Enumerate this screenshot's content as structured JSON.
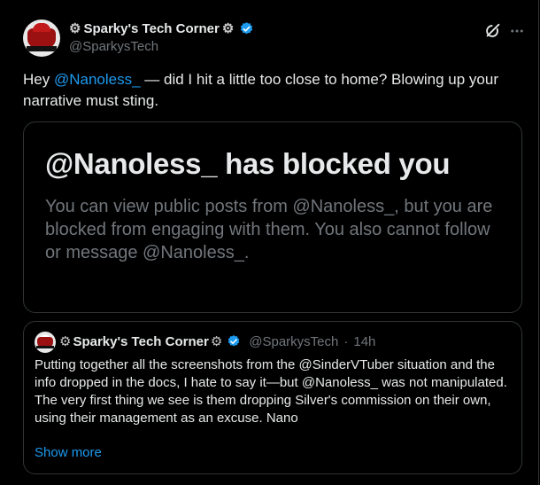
{
  "author": {
    "gear_left": "⚙",
    "name": "Sparky's Tech Corner",
    "gear_right": "⚙",
    "handle": "@SparkysTech"
  },
  "post": {
    "prefix": "Hey ",
    "mention": "@Nanoless_",
    "rest": " — did I hit a little too close to home? Blowing up your narrative must sting."
  },
  "screenshot": {
    "title": "@Nanoless_ has blocked you",
    "body": "You can view public posts from @Nanoless_, but you are blocked from engaging with them. You also cannot follow or message @Nanoless_."
  },
  "quote": {
    "gear_left": "⚙",
    "name": "Sparky's Tech Corner",
    "gear_right": "⚙",
    "handle": "@SparkysTech",
    "separator": "·",
    "time": "14h",
    "text": "Putting together all the screenshots from the @SinderVTuber situation and the info dropped in the docs, I hate to say it—but @Nanoless_ was not manipulated.\nThe very first thing we see is them dropping Silver's commission on their own, using their management as an excuse. Nano",
    "show_more": "Show more"
  },
  "icons": {
    "verified": "verified-badge-icon",
    "grok": "grok-icon",
    "more": "more-options-icon"
  },
  "colors": {
    "background": "#000000",
    "text": "#e7e9ea",
    "muted": "#71767b",
    "accent": "#1d9bf0",
    "border": "#2f3336"
  }
}
